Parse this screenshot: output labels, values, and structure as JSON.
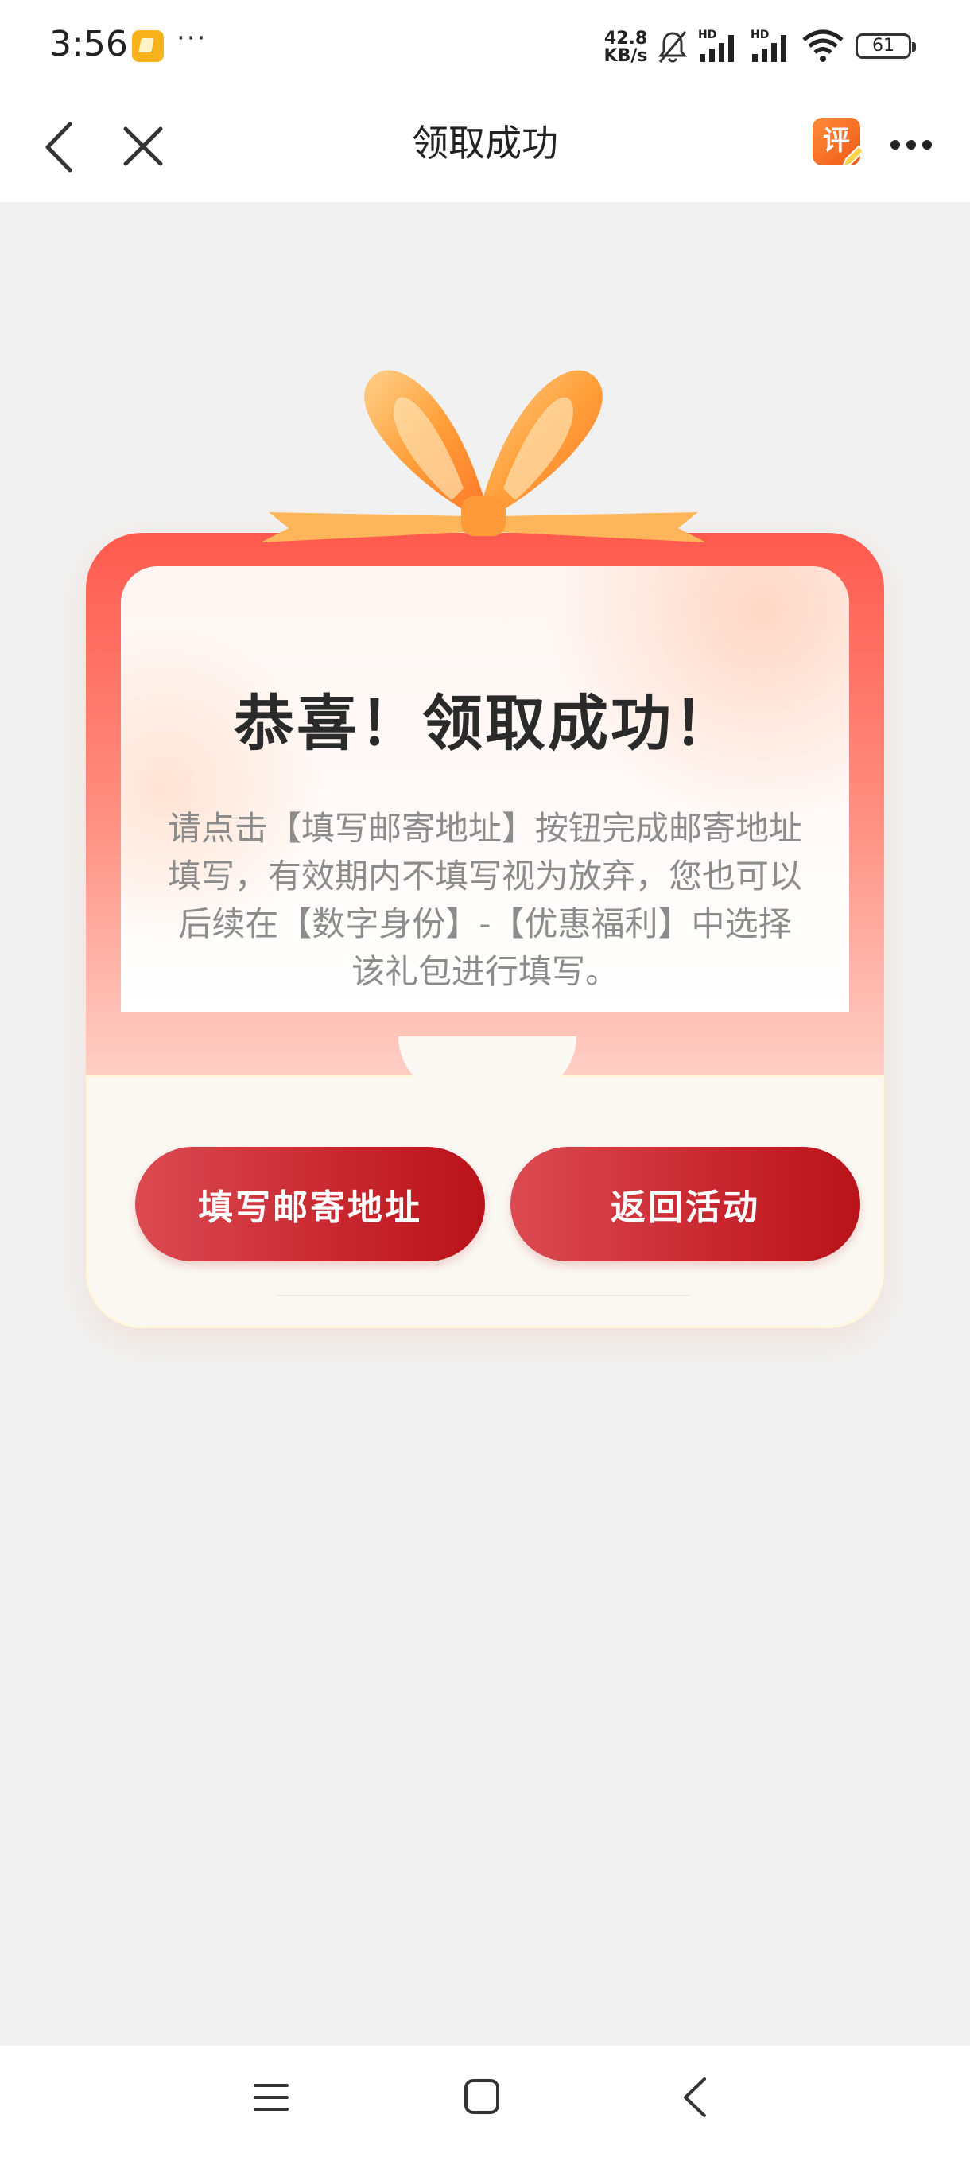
{
  "status_bar": {
    "time": "3:56",
    "dots": "···",
    "net_speed_value": "42.8",
    "net_speed_unit": "KB/s",
    "signal_label": "HD",
    "battery": "61",
    "icons": [
      "app-notification-icon",
      "bell-muted-icon",
      "signal-icon",
      "wifi-icon",
      "battery-icon"
    ]
  },
  "titlebar": {
    "title": "领取成功",
    "review_badge": "评",
    "icons": [
      "back-icon",
      "close-icon",
      "review-icon",
      "more-icon"
    ]
  },
  "card": {
    "title": "恭喜！领取成功！",
    "description": "请点击【填写邮寄地址】按钮完成邮寄地址填写，有效期内不填写视为放弃，您也可以后续在【数字身份】-【优惠福利】中选择该礼包进行填写。",
    "primary_button": "填写邮寄地址",
    "secondary_button": "返回活动"
  },
  "colors": {
    "button": "#c8262e",
    "frame_top": "#ff5a4e",
    "bow": "#ffa340",
    "background": "#f1f1f1"
  },
  "navbar": {
    "icons": [
      "menu-icon",
      "home-icon",
      "back-nav-icon"
    ]
  }
}
